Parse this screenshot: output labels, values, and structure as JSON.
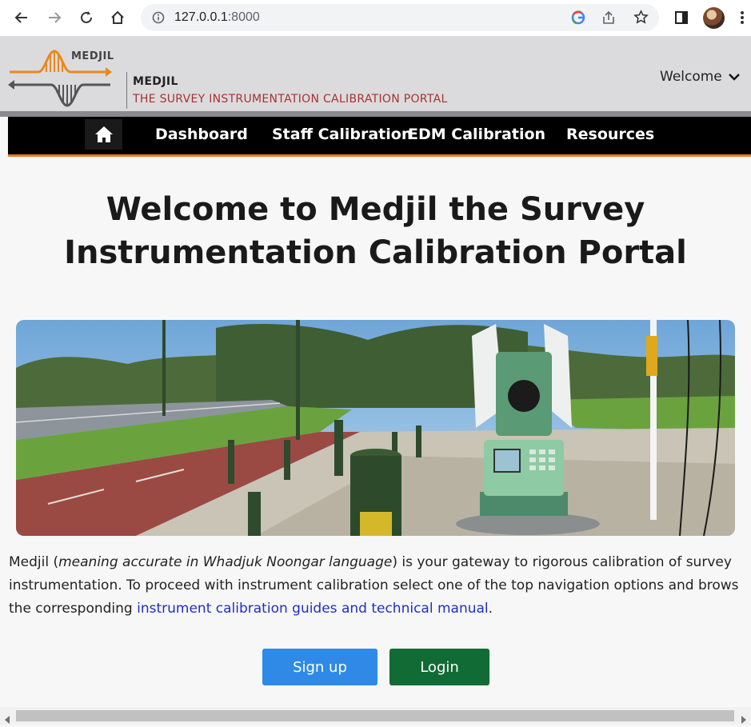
{
  "browser": {
    "url_host": "127.0.0.1",
    "url_port": ":8000"
  },
  "site": {
    "logo_text": "MEDJIL",
    "brand_name": "MEDJIL",
    "brand_subtitle": "THE SURVEY INSTRUMENTATION CALIBRATION PORTAL",
    "welcome_label": "Welcome"
  },
  "nav": {
    "items": [
      "Dashboard",
      "Staff Calibration",
      "EDM Calibration",
      "Resources"
    ]
  },
  "main": {
    "title_line1": "Welcome to Medjil the Survey",
    "title_line2": "Instrumentation Calibration Portal",
    "desc_part1": "Medjil (",
    "desc_italic": "meaning accurate in Whadjuk Noongar language",
    "desc_part2": ") is your gateway to rigorous calibration of survey instrumentation. To proceed with instrument calibration select one of the top navigation options and brows the corresponding ",
    "desc_link": "instrument calibration guides and technical manual",
    "desc_part3": ".",
    "signup_label": "Sign up",
    "login_label": "Login"
  },
  "colors": {
    "accent_orange": "#e07b2a",
    "subtitle_red": "#a83232",
    "signup_blue": "#2e8ae6",
    "login_green": "#116b34"
  }
}
